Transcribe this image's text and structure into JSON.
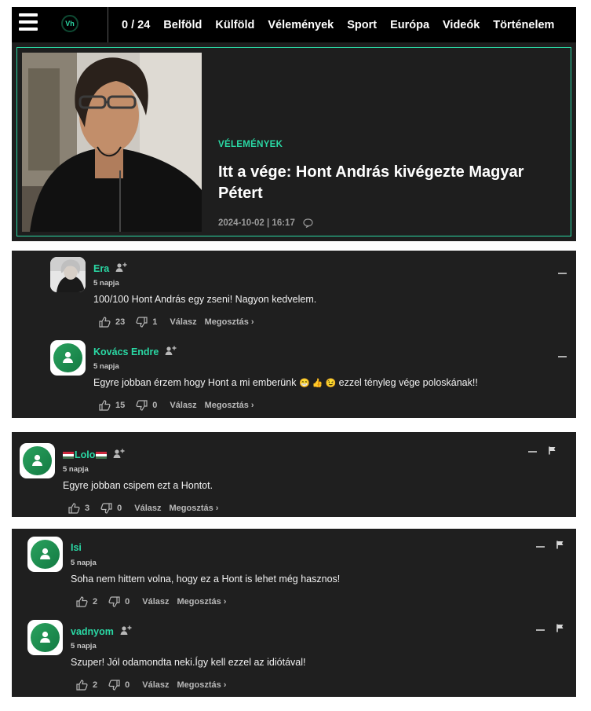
{
  "nav": {
    "logo": "Vh",
    "counter": "0 / 24",
    "links": [
      "Belföld",
      "Külföld",
      "Vélemények",
      "Sport",
      "Európa",
      "Videók",
      "Történelem"
    ]
  },
  "article": {
    "category": "VÉLEMÉNYEK",
    "title": "Itt a vége: Hont András kivégezte Magyar Pétert",
    "meta": "2024-10-02 | 16:17"
  },
  "comments": [
    {
      "name": "Era",
      "time": "5 napja",
      "text": "100/100 Hont András egy zseni! Nagyon kedvelem.",
      "likes": "23",
      "dislikes": "1",
      "reply": "Válasz",
      "share": "Megosztás ›"
    },
    {
      "name": "Kovács Endre",
      "time": "5 napja",
      "text_before": "Egyre jobban érzem hogy Hont a mi emberünk",
      "emojis": "😁 👍 😉",
      "text_after": " ezzel tényleg vége poloskának!!",
      "likes": "15",
      "dislikes": "0",
      "reply": "Válasz",
      "share": "Megosztás ›"
    },
    {
      "name": "Lolo",
      "time": "5 napja",
      "text": "Egyre jobban csipem ezt a Hontot.",
      "likes": "3",
      "dislikes": "0",
      "reply": "Válasz",
      "share": "Megosztás ›"
    },
    {
      "name": "Isi",
      "time": "5 napja",
      "text": "Soha nem hittem volna, hogy ez a Hont is lehet még hasznos!",
      "likes": "2",
      "dislikes": "0",
      "reply": "Válasz",
      "share": "Megosztás ›"
    },
    {
      "name": "vadnyom",
      "time": "5 napja",
      "text": "Szuper! Jól odamondta neki.Így kell ezzel az idiótával!",
      "likes": "2",
      "dislikes": "0",
      "reply": "Válasz",
      "share": "Megosztás ›"
    }
  ],
  "colors": {
    "accent": "#2ad8a4",
    "panel": "#1f1f1f",
    "nav": "#000000",
    "avatar_green": "#1f8e50"
  },
  "icons": [
    "menu-icon",
    "thumbs-up-icon",
    "thumbs-down-icon",
    "follow-user-icon",
    "collapse-icon",
    "flag-icon",
    "comment-icon",
    "hungarian-flag-icon"
  ]
}
